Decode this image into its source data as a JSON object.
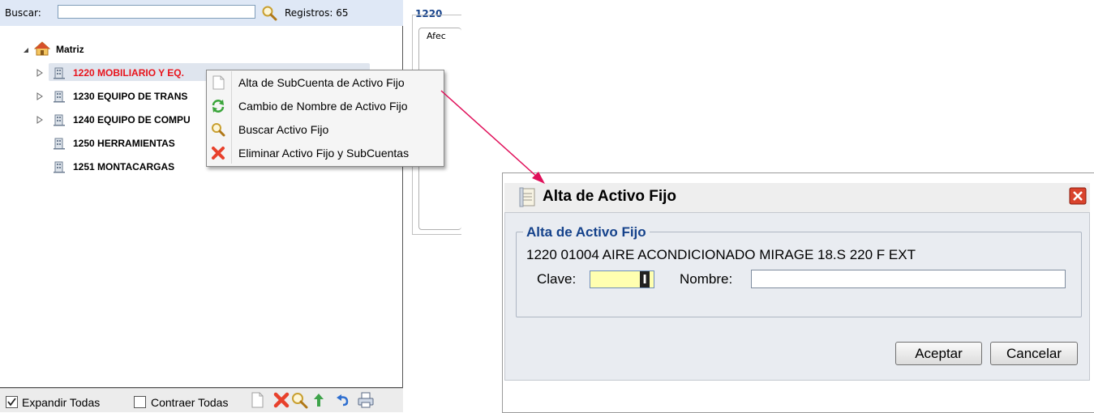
{
  "search": {
    "label": "Buscar:",
    "value": "",
    "records_label": "Registros: 65"
  },
  "tree": {
    "root_label": "Matriz",
    "items": [
      {
        "label": "1220 MOBILIARIO Y EQ.",
        "expandable": true,
        "selected": true
      },
      {
        "label": "1230 EQUIPO DE TRANS",
        "expandable": true,
        "selected": false
      },
      {
        "label": "1240 EQUIPO DE COMPU",
        "expandable": true,
        "selected": false
      },
      {
        "label": "1250 HERRAMIENTAS",
        "expandable": false,
        "selected": false
      },
      {
        "label": "1251 MONTACARGAS",
        "expandable": false,
        "selected": false
      }
    ]
  },
  "context_menu": {
    "items": [
      {
        "label": "Alta de SubCuenta de Activo Fijo",
        "icon": "page-icon"
      },
      {
        "label": "Cambio de Nombre de Activo Fijo",
        "icon": "refresh-icon"
      },
      {
        "label": "Buscar Activo Fijo",
        "icon": "search-icon"
      },
      {
        "label": "Eliminar Activo Fijo y SubCuentas",
        "icon": "delete-icon"
      }
    ]
  },
  "bottom_toolbar": {
    "expand_all_label": "Expandir Todas",
    "expand_all_checked": true,
    "collapse_all_label": "Contraer Todas",
    "collapse_all_checked": false
  },
  "background_panel": {
    "title": "1220",
    "partial_text": "Afec"
  },
  "dialog": {
    "title": "Alta de Activo Fijo",
    "legend": "Alta de Activo Fijo",
    "asset_description": "1220 01004 AIRE ACONDICIONADO MIRAGE 18.S 220 F EXT",
    "clave_label": "Clave:",
    "clave_value": "",
    "nombre_label": "Nombre:",
    "nombre_value": "",
    "accept_label": "Aceptar",
    "cancel_label": "Cancelar"
  },
  "colors": {
    "selected_text": "#e8141c",
    "accent_blue": "#15428b",
    "arrow": "#e0105a",
    "clave_bg": "#ffffb0"
  }
}
